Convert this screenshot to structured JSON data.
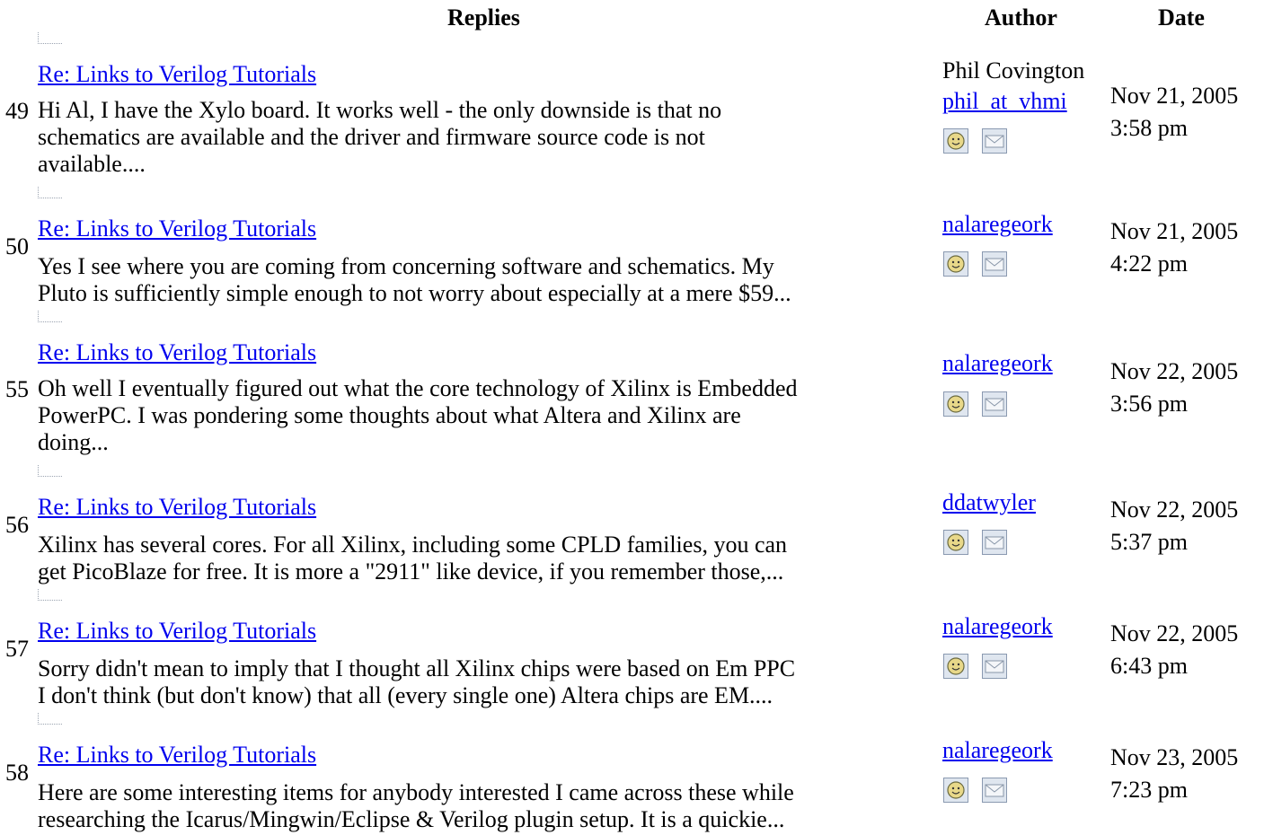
{
  "header": {
    "replies": "Replies",
    "author": "Author",
    "date": "Date"
  },
  "posts": [
    {
      "number": "49",
      "title": "Re: Links to Verilog Tutorials",
      "excerpt": "Hi Al, I have the Xylo board. It works well - the only downside is that no\nschematics are available and the driver and firmware source code is not\navailable....",
      "author_name": "Phil Covington",
      "author_user": "phil_at_vhmi",
      "date": "Nov 21, 2005\n3:58 pm",
      "profile_icon": "profile-face-icon",
      "email_icon": "envelope-icon"
    },
    {
      "number": "50",
      "title": "Re: Links to Verilog Tutorials",
      "excerpt": "Yes I see where you are coming from concerning software and schematics. My\nPluto is sufficiently simple enough to not worry about especially at a mere $59...",
      "author_user": "nalaregeork",
      "date": "Nov 21, 2005\n4:22 pm",
      "profile_icon": "profile-face-icon",
      "email_icon": "envelope-icon"
    },
    {
      "number": "55",
      "title": "Re: Links to Verilog Tutorials",
      "excerpt": "Oh well I eventually figured out what the core technology of Xilinx is Embedded\nPowerPC. I was pondering some thoughts about what Altera and Xilinx are\ndoing...",
      "author_user": "nalaregeork",
      "date": "Nov 22, 2005\n3:56 pm",
      "profile_icon": "profile-face-icon",
      "email_icon": "envelope-icon"
    },
    {
      "number": "56",
      "title": "Re: Links to Verilog Tutorials",
      "excerpt": "Xilinx has several cores. For all Xilinx, including some CPLD families, you can\nget PicoBlaze for free. It is more a \"2911\" like device, if you remember those,...",
      "author_user": "ddatwyler",
      "date": "Nov 22, 2005\n5:37 pm",
      "profile_icon": "profile-face-icon",
      "email_icon": "envelope-icon"
    },
    {
      "number": "57",
      "title": "Re: Links to Verilog Tutorials",
      "excerpt": "Sorry didn't mean to imply that I thought all Xilinx chips were based on Em PPC\nI don't think (but don't know) that all (every single one) Altera chips are EM....",
      "author_user": "nalaregeork",
      "date": "Nov 22, 2005\n6:43 pm",
      "profile_icon": "profile-face-icon",
      "email_icon": "envelope-icon"
    },
    {
      "number": "58",
      "title": "Re: Links to Verilog Tutorials",
      "excerpt": "Here are some interesting items for anybody interested I came across these while\nresearching the Icarus/Mingwin/Eclipse & Verilog plugin setup. It is a quickie...",
      "author_user": "nalaregeork",
      "date": "Nov 23, 2005\n7:23 pm",
      "profile_icon": "profile-face-icon",
      "email_icon": "envelope-icon"
    }
  ]
}
